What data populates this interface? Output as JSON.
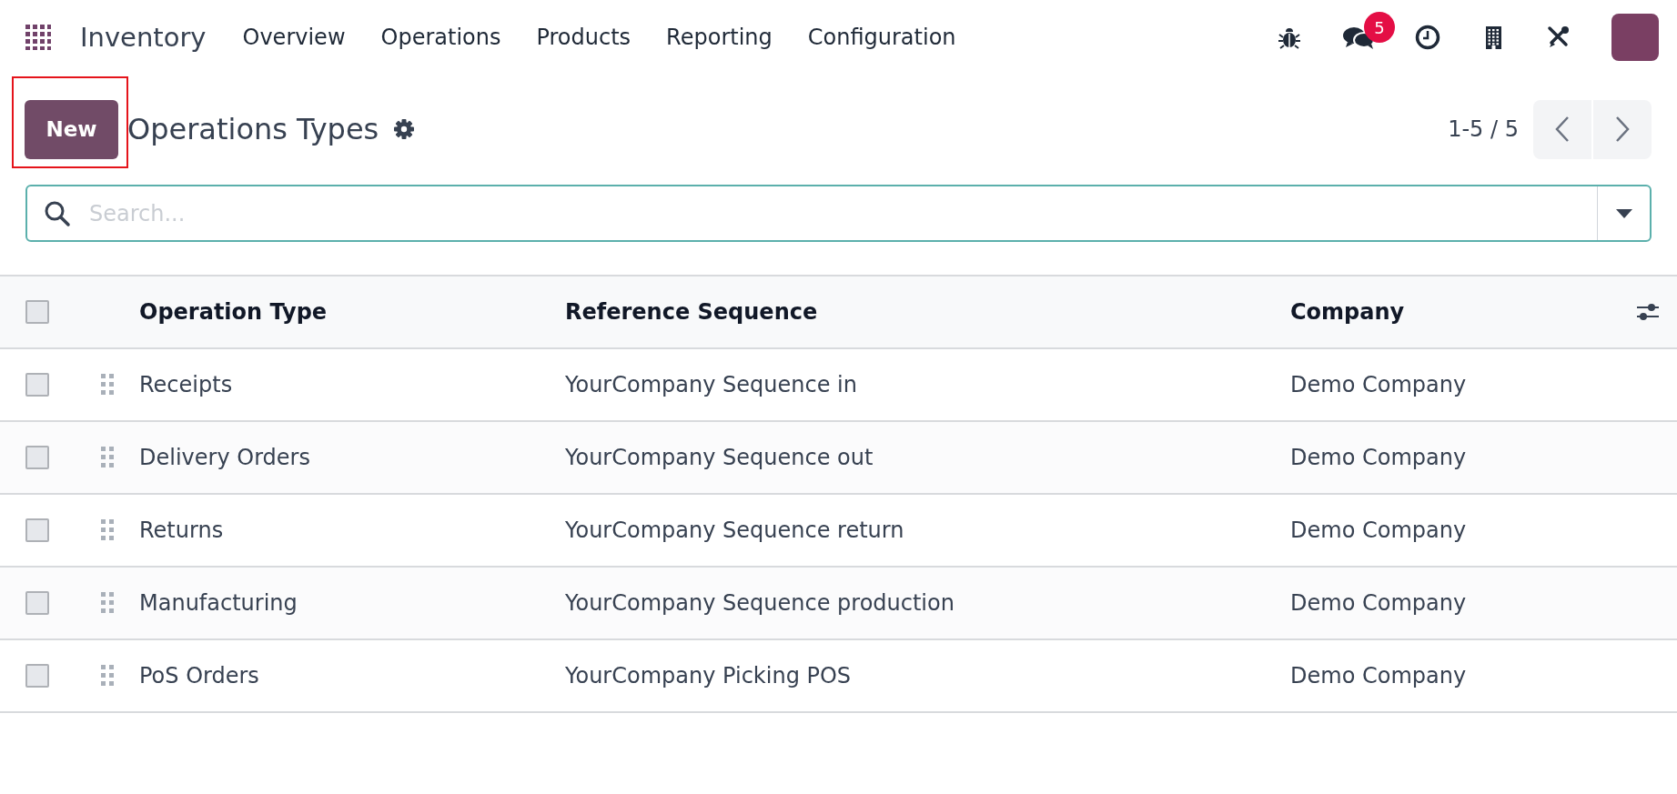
{
  "navbar": {
    "app_name": "Inventory",
    "menu": [
      "Overview",
      "Operations",
      "Products",
      "Reporting",
      "Configuration"
    ],
    "messages_badge": "5"
  },
  "control_panel": {
    "new_button": "New",
    "title": "Operations Types",
    "pager": "1-5 / 5"
  },
  "search": {
    "placeholder": "Search..."
  },
  "table": {
    "select_all_checked": false,
    "columns": [
      "Operation Type",
      "Reference Sequence",
      "Company"
    ],
    "rows": [
      {
        "checked": false,
        "cells": [
          "Receipts",
          "YourCompany Sequence in",
          "Demo Company"
        ]
      },
      {
        "checked": false,
        "cells": [
          "Delivery Orders",
          "YourCompany Sequence out",
          "Demo Company"
        ]
      },
      {
        "checked": false,
        "cells": [
          "Returns",
          "YourCompany Sequence return",
          "Demo Company"
        ]
      },
      {
        "checked": false,
        "cells": [
          "Manufacturing",
          "YourCompany Sequence production",
          "Demo Company"
        ]
      },
      {
        "checked": false,
        "cells": [
          "PoS Orders",
          "YourCompany Picking POS",
          "Demo Company"
        ]
      }
    ]
  }
}
